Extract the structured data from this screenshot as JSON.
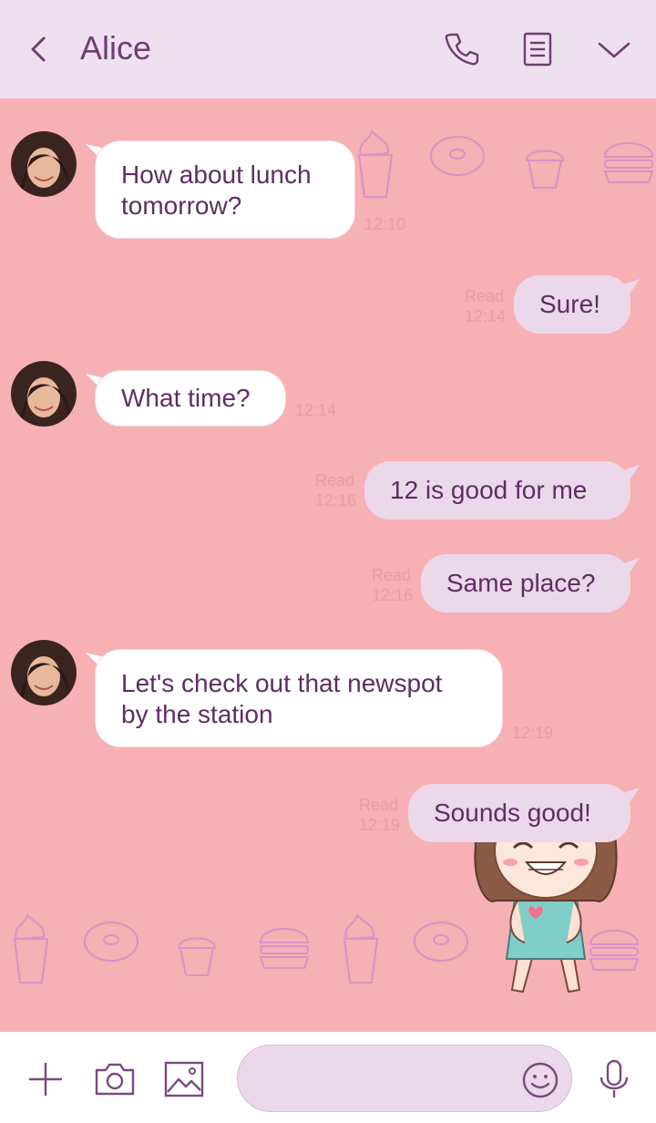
{
  "header": {
    "title": "Alice",
    "icons": [
      "back-chevron-icon",
      "phone-icon",
      "notes-icon",
      "chevron-down-icon"
    ]
  },
  "messages": [
    {
      "direction": "incoming",
      "lines": [
        "How about lunch",
        "tomorrow?"
      ],
      "time": "12:10"
    },
    {
      "direction": "outgoing",
      "lines": [
        "Sure!"
      ],
      "read": "Read",
      "time": "12:14"
    },
    {
      "direction": "incoming",
      "lines": [
        "What time?"
      ],
      "time": "12:14"
    },
    {
      "direction": "outgoing",
      "lines": [
        "12 is good for me"
      ],
      "read": "Read",
      "time": "12:16"
    },
    {
      "direction": "outgoing",
      "lines": [
        "Same place?"
      ],
      "read": "Read",
      "time": "12:16"
    },
    {
      "direction": "incoming",
      "lines": [
        "Let's check out that newspot",
        "by the station"
      ],
      "time": "12:19"
    },
    {
      "direction": "outgoing",
      "lines": [
        "Sounds good!"
      ],
      "read": "Read",
      "time": "12:19"
    }
  ],
  "footer": {
    "input_placeholder": "",
    "icons": [
      "plus-icon",
      "camera-icon",
      "image-icon",
      "emoji-icon",
      "microphone-icon"
    ]
  },
  "colors": {
    "chat_background": "#f7b0b4",
    "header_background": "#efe0ef",
    "incoming_bubble": "#ffffff",
    "outgoing_bubble": "#ebd8ea",
    "text": "#5f2d64",
    "meta_text": "#e79ea9"
  }
}
